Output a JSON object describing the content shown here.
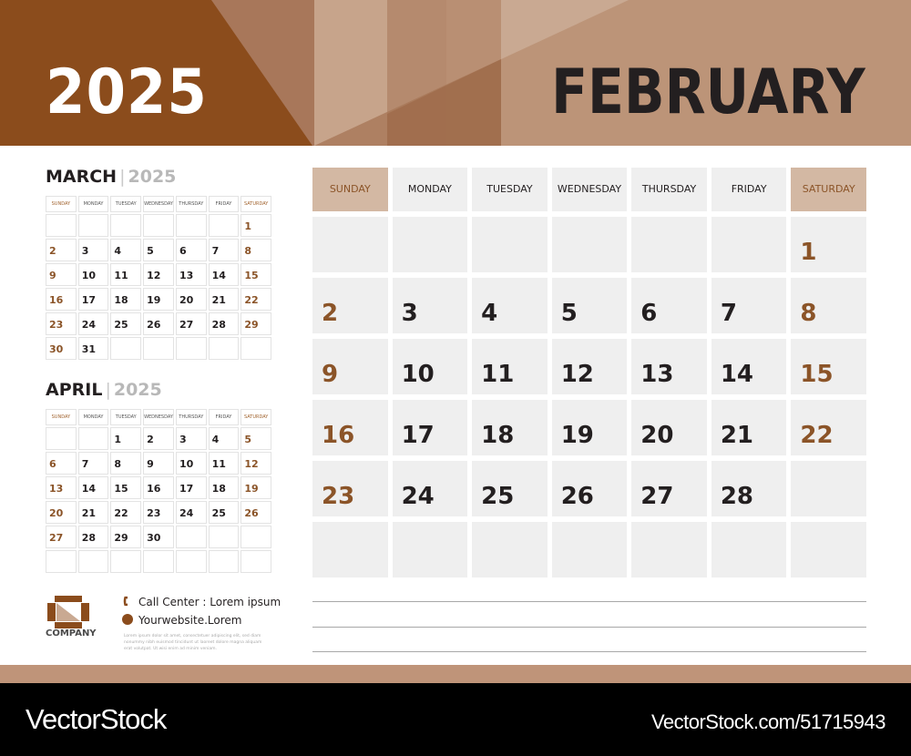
{
  "header": {
    "year": "2025",
    "month": "FEBRUARY"
  },
  "colors": {
    "brand_dark": "#8b4c1c",
    "brand_light": "#bc9478",
    "weekend_text": "#8b5428",
    "weekend_header_bg": "#d3b8a3",
    "cell_bg": "#efefef"
  },
  "weekday_labels_long": [
    "SUNDAY",
    "MONDAY",
    "TUESDAY",
    "WEDNESDAY",
    "THURSDAY",
    "FRIDAY",
    "SATURDAY"
  ],
  "main_calendar": {
    "month": "FEBRUARY",
    "year": "2025",
    "weeks": [
      [
        "",
        "",
        "",
        "",
        "",
        "",
        "1"
      ],
      [
        "2",
        "3",
        "4",
        "5",
        "6",
        "7",
        "8"
      ],
      [
        "9",
        "10",
        "11",
        "12",
        "13",
        "14",
        "15"
      ],
      [
        "16",
        "17",
        "18",
        "19",
        "20",
        "21",
        "22"
      ],
      [
        "23",
        "24",
        "25",
        "26",
        "27",
        "28",
        ""
      ],
      [
        "",
        "",
        "",
        "",
        "",
        "",
        ""
      ]
    ]
  },
  "mini_calendars": [
    {
      "month": "MARCH",
      "year": "2025",
      "weeks": [
        [
          "",
          "",
          "",
          "",
          "",
          "",
          "1"
        ],
        [
          "2",
          "3",
          "4",
          "5",
          "6",
          "7",
          "8"
        ],
        [
          "9",
          "10",
          "11",
          "12",
          "13",
          "14",
          "15"
        ],
        [
          "16",
          "17",
          "18",
          "19",
          "20",
          "21",
          "22"
        ],
        [
          "23",
          "24",
          "25",
          "26",
          "27",
          "28",
          "29"
        ],
        [
          "30",
          "31",
          "",
          "",
          "",
          "",
          ""
        ]
      ]
    },
    {
      "month": "APRIL",
      "year": "2025",
      "weeks": [
        [
          "",
          "",
          "1",
          "2",
          "3",
          "4",
          "5"
        ],
        [
          "6",
          "7",
          "8",
          "9",
          "10",
          "11",
          "12"
        ],
        [
          "13",
          "14",
          "15",
          "16",
          "17",
          "18",
          "19"
        ],
        [
          "20",
          "21",
          "22",
          "23",
          "24",
          "25",
          "26"
        ],
        [
          "27",
          "28",
          "29",
          "30",
          "",
          "",
          ""
        ],
        [
          "",
          "",
          "",
          "",
          "",
          "",
          ""
        ]
      ]
    }
  ],
  "company": {
    "name": "COMPANY",
    "call_center": "Call Center : Lorem ipsum",
    "website": "Yourwebsite.Lorem",
    "fine_print": "Lorem ipsum dolor sit amet, consectetuer adipiscing elit, sed diam nonummy nibh euismod tincidunt ut laoreet dolore magna aliquam erat volutpat. Ut wisi enim ad minim veniam."
  },
  "footer": {
    "brand": "VectorStock",
    "url": "VectorStock.com/51715943"
  }
}
